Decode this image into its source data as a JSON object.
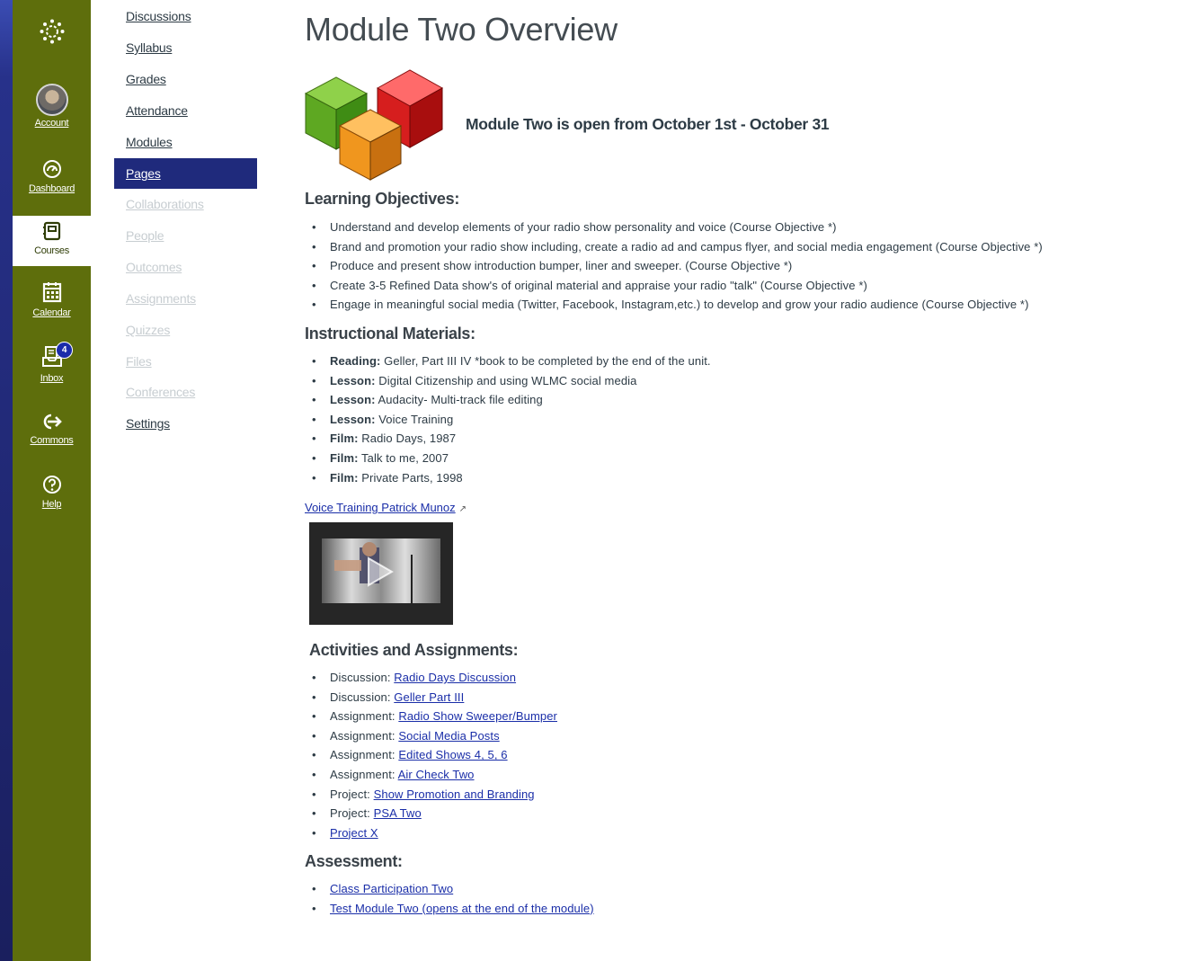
{
  "global_nav": {
    "items": [
      {
        "name": "account",
        "label": "Account",
        "icon": "account-avatar"
      },
      {
        "name": "dashboard",
        "label": "Dashboard",
        "icon": "dashboard-icon"
      },
      {
        "name": "courses",
        "label": "Courses",
        "icon": "courses-icon",
        "active": true
      },
      {
        "name": "calendar",
        "label": "Calendar",
        "icon": "calendar-icon"
      },
      {
        "name": "inbox",
        "label": "Inbox",
        "icon": "inbox-icon",
        "badge": "4"
      },
      {
        "name": "commons",
        "label": "Commons",
        "icon": "commons-icon"
      },
      {
        "name": "help",
        "label": "Help",
        "icon": "help-icon"
      }
    ]
  },
  "course_nav": {
    "items": [
      {
        "label": "Discussions",
        "state": "enabled"
      },
      {
        "label": "Syllabus",
        "state": "enabled"
      },
      {
        "label": "Grades",
        "state": "enabled"
      },
      {
        "label": "Attendance",
        "state": "enabled"
      },
      {
        "label": "Modules",
        "state": "enabled"
      },
      {
        "label": "Pages",
        "state": "active"
      },
      {
        "label": "Collaborations",
        "state": "disabled"
      },
      {
        "label": "People",
        "state": "disabled"
      },
      {
        "label": "Outcomes",
        "state": "disabled"
      },
      {
        "label": "Assignments",
        "state": "disabled"
      },
      {
        "label": "Quizzes",
        "state": "disabled"
      },
      {
        "label": "Files",
        "state": "disabled"
      },
      {
        "label": "Conferences",
        "state": "disabled"
      },
      {
        "label": "Settings",
        "state": "enabled"
      }
    ]
  },
  "page": {
    "title": "Module Two Overview",
    "open_text": "Module Two is open from October 1st - October 31",
    "learning_objectives": {
      "heading": "Learning Objectives:",
      "items": [
        "Understand and develop elements of your radio show personality and voice (Course Objective *)",
        "Brand and promotion your radio show including, create a radio ad and campus flyer, and social media engagement (Course Objective *)",
        "Produce and present show introduction bumper, liner and sweeper. (Course Objective *)",
        "Create 3-5 Refined Data show's of original material and appraise your radio \"talk\" (Course Objective *)",
        "Engage in  meaningful social media (Twitter, Facebook, Instagram,etc.) to develop and grow your radio audience (Course Objective *)"
      ]
    },
    "instructional_materials": {
      "heading": "Instructional Materials:",
      "items": [
        {
          "label": "Reading:",
          "text": " Geller, Part III IV *book to be completed by the end of the unit."
        },
        {
          "label": "Lesson:",
          "text": " Digital Citizenship and using WLMC social media"
        },
        {
          "label": "Lesson:",
          "text": "  Audacity- Multi-track file editing"
        },
        {
          "label": "Lesson:",
          "text": " Voice Training"
        },
        {
          "label": "Film:",
          "text": "  Radio Days, 1987"
        },
        {
          "label": "Film:",
          "text": " Talk to me, 2007"
        },
        {
          "label": "Film:",
          "text": " Private Parts, 1998"
        }
      ]
    },
    "video_link": "Voice Training Patrick Munoz",
    "activities": {
      "heading": "Activities and Assignments:",
      "items": [
        {
          "prefix": "Discussion:  ",
          "link": "Radio Days Discussion"
        },
        {
          "prefix": "Discussion: ",
          "link": "Geller Part III"
        },
        {
          "prefix": "Assignment: ",
          "link": "Radio Show Sweeper/Bumper"
        },
        {
          "prefix": "Assignment: ",
          "link": "Social Media Posts"
        },
        {
          "prefix": "Assignment: ",
          "link": "Edited Shows 4, 5, 6"
        },
        {
          "prefix": "Assignment: ",
          "link": "Air Check Two"
        },
        {
          "prefix": "Project:  ",
          "link": "Show Promotion and Branding"
        },
        {
          "prefix": "Project: ",
          "link": "PSA Two"
        },
        {
          "prefix": "",
          "link": "Project X"
        }
      ]
    },
    "assessment": {
      "heading": "Assessment:",
      "items": [
        "Class Participation Two",
        "Test Module Two (opens at the end of the module)"
      ]
    }
  },
  "colors": {
    "global_nav_bg": "#5e6e0c",
    "active_course_nav": "#1f2a7c",
    "link": "#1a2ea8",
    "frame": "#1a1f5e"
  }
}
